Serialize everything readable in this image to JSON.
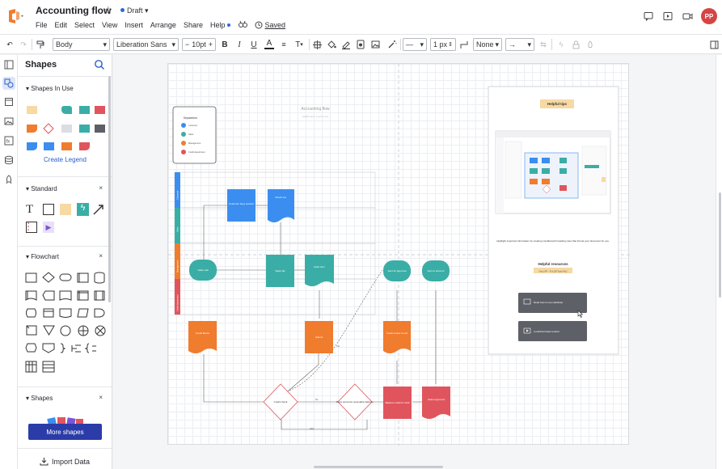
{
  "header": {
    "title": "Accounting flow",
    "status": "Draft",
    "menu": [
      "File",
      "Edit",
      "Select",
      "View",
      "Insert",
      "Arrange",
      "Share",
      "Help"
    ],
    "saved": "Saved",
    "avatar_initials": "PP"
  },
  "toolbar": {
    "style_select": "Body",
    "font_select": "Liberation Sans",
    "font_size": "10pt",
    "line_width": "1 px",
    "arrow_start": "None"
  },
  "panel": {
    "title": "Shapes",
    "sections": {
      "in_use": "Shapes In Use",
      "standard": "Standard",
      "flowchart": "Flowchart",
      "shapes": "Shapes"
    },
    "create_legend": "Create Legend",
    "more_shapes": "More shapes",
    "import_data": "Import Data"
  },
  "diagram": {
    "title": "Accounting flow",
    "subtitle": "Helpful tips | Learn more",
    "legend_title": "Department",
    "legend_items": [
      "Customer",
      "Sales",
      "Management",
      "Credit department"
    ],
    "lanes": [
      "Customer",
      "Sales",
      "Management",
      "Credit department"
    ],
    "nodes": {
      "customer_buys": "Customer buys product",
      "check_out": "Check out",
      "sales_call": "Sales call",
      "sales_file": "Sales file",
      "clear_item": "Clear item",
      "sent_approval": "Sent for approval",
      "sent_account": "Sent to account",
      "credit_memo": "Credit Memo",
      "submit": "Submit",
      "credit_review": "Credit review to exit",
      "credit_check": "Credit check",
      "does_account": "Does accounts receivable balance",
      "balance_credit": "Balance credit for hold",
      "sales_approved": "Sales approved"
    },
    "edge_labels": [
      "Yes",
      "No",
      "Approve",
      "High"
    ]
  },
  "tips": {
    "title": "Helpful tips",
    "body": "Highlight important information by creating conditional formatting rules that format your document for you.",
    "resources_title": "Helpful resources",
    "resources_sub": "Visit LPP – R & QR Tools FAQ",
    "btn1": "Read how to use substitute",
    "btn2": "Lucidchart basic tutorial"
  },
  "colors": {
    "accent": "#2b3ca8",
    "blue": "#3b8ef0",
    "teal": "#3aaea6",
    "orange": "#f07c2e",
    "red": "#e0555d",
    "avatar": "#d64545"
  }
}
